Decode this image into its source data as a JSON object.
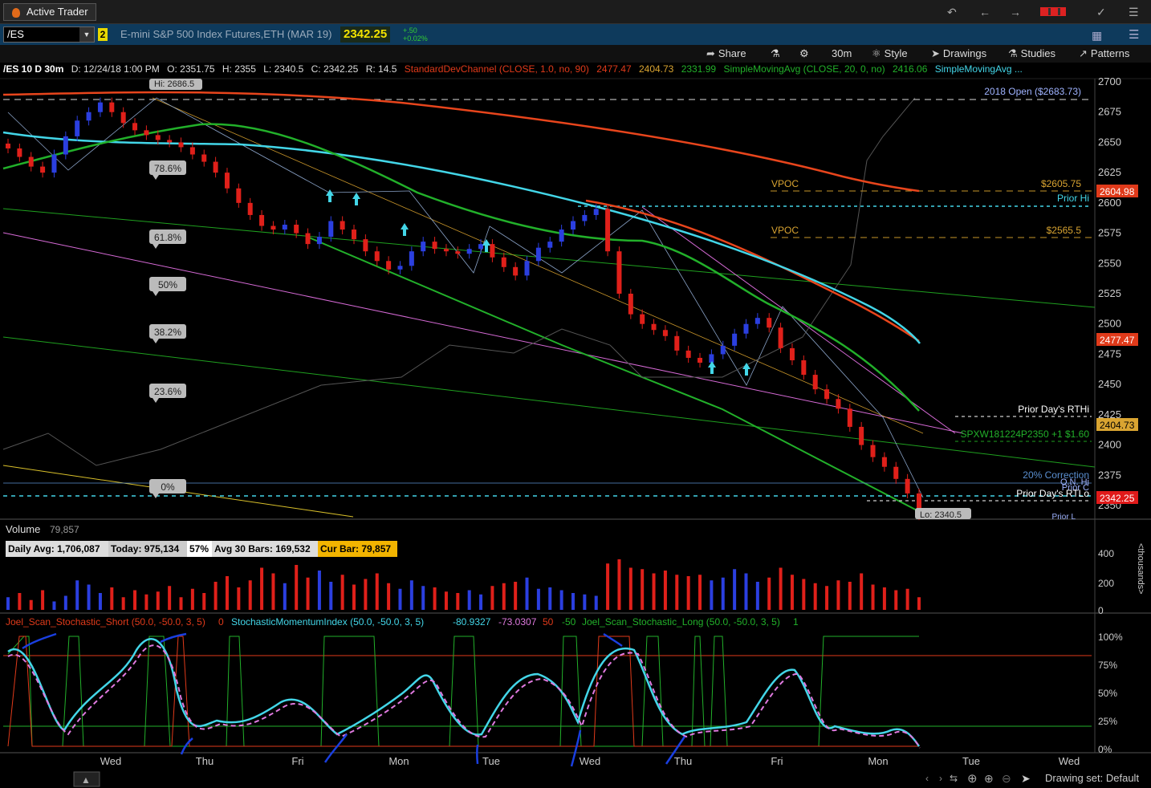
{
  "app": {
    "title": "Active Trader"
  },
  "symbol": {
    "ticker": "/ES",
    "link": "2",
    "description": "E-mini S&P 500 Index Futures,ETH (MAR 19)",
    "last": "2342.25",
    "change": "+.50",
    "change_pct": "+0.02%"
  },
  "toolbar": {
    "share": "Share",
    "timeframe": "30m",
    "style": "Style",
    "drawings": "Drawings",
    "studies": "Studies",
    "patterns": "Patterns"
  },
  "infobar": {
    "chart_name": "/ES 10 D 30m",
    "date": "D: 12/24/18 1:00 PM",
    "open": "O: 2351.75",
    "high": "H: 2355",
    "low": "L: 2340.5",
    "close": "C: 2342.25",
    "range": "R: 14.5",
    "sdc_label": "StandardDevChannel (CLOSE, 1.0, no, 90)",
    "sdc_v1": "2477.47",
    "sdc_v2": "2404.73",
    "sdc_v3": "2331.99",
    "sma_label": "SimpleMovingAvg (CLOSE, 20, 0, no)",
    "sma_v": "2416.06",
    "sma2_label": "SimpleMovingAvg ..."
  },
  "price_axis": {
    "ticks": [
      "2700",
      "2675",
      "2650",
      "2625",
      "2600",
      "2575",
      "2550",
      "2525",
      "2500",
      "2475",
      "2450",
      "2425",
      "2400",
      "2375",
      "2350"
    ],
    "badges": {
      "top": "2604.98",
      "mid": "2477.47",
      "sdc": "2404.73",
      "last": "2342.25"
    }
  },
  "annotations": {
    "hi": "Hi: 2686.5",
    "lo": "Lo: 2340.5",
    "open_2018": "2018 Open ($2683.73)",
    "vpoc1": "VPOC",
    "vpoc1_price": "$2605.75",
    "prior_hi": "Prior Hi",
    "vpoc2": "VPOC",
    "vpoc2_price": "$2565.5",
    "prior_rthi": "Prior Day's RTHi",
    "spxw": "SPXW181224P2350 +1 $1.60",
    "correction": "20% Correction",
    "on_hi": "O.N. Hi",
    "prior_c": "Prior C",
    "prior_rtlo": "Prior Day's RTLo",
    "prior_lo": "Prior L",
    "fib": [
      "78.6%",
      "61.8%",
      "50%",
      "38.2%",
      "23.6%",
      "0%"
    ]
  },
  "volume": {
    "title": "Volume",
    "value": "79,857",
    "daily_avg": "Daily Avg: 1,706,087",
    "today": "Today: 975,134",
    "pct": "57%",
    "avg30": "Avg 30 Bars: 169,532",
    "cur_bar": "Cur Bar: 79,857",
    "ticks": [
      "400",
      "200",
      "0"
    ],
    "unit": "<thousands>"
  },
  "oscillator": {
    "short_label": "Joel_Scan_Stochastic_Short (50.0, -50.0, 3, 5)",
    "short_val": "0",
    "smi_label": "StochasticMomentumIndex (50.0, -50.0, 3, 5)",
    "smi_v1": "-80.9327",
    "smi_v2": "-73.0307",
    "smi_v3": "50",
    "smi_v4": "-50",
    "long_label": "Joel_Scan_Stochastic_Long (50.0, -50.0, 3, 5)",
    "long_val": "1",
    "ticks": [
      "100%",
      "75%",
      "50%",
      "25%",
      "0%"
    ]
  },
  "time_axis": [
    "Wed",
    "Thu",
    "Fri",
    "Mon",
    "Tue",
    "Wed",
    "Thu",
    "Fri",
    "Mon",
    "Tue",
    "Wed"
  ],
  "footer": {
    "drawing_set": "Drawing set: Default"
  },
  "colors": {
    "up": "#2b3fe0",
    "down": "#e0201a",
    "sma_cyan": "#43d6e8",
    "sma_green": "#22b02a",
    "sma_red": "#e8451c",
    "pink": "#e07ae0",
    "gold": "#d9a431"
  },
  "chart_data": {
    "type": "candlestick",
    "title": "/ES 10 D 30m",
    "ylim": [
      2335,
      2705
    ],
    "close": [
      2645,
      2638,
      2630,
      2625,
      2640,
      2655,
      2668,
      2675,
      2683,
      2675,
      2666,
      2660,
      2656,
      2652,
      2650,
      2646,
      2640,
      2634,
      2625,
      2612,
      2600,
      2590,
      2581,
      2578,
      2582,
      2575,
      2566,
      2572,
      2585,
      2578,
      2570,
      2560,
      2552,
      2545,
      2548,
      2560,
      2568,
      2562,
      2560,
      2558,
      2562,
      2566,
      2555,
      2547,
      2540,
      2552,
      2563,
      2568,
      2578,
      2585,
      2590,
      2595,
      2560,
      2525,
      2508,
      2500,
      2495,
      2490,
      2478,
      2472,
      2468,
      2475,
      2482,
      2492,
      2500,
      2505,
      2497,
      2480,
      2470,
      2458,
      2446,
      2438,
      2430,
      2415,
      2400,
      2390,
      2382,
      2372,
      2360,
      2342
    ],
    "volume_k": [
      90,
      120,
      70,
      140,
      60,
      100,
      210,
      180,
      120,
      160,
      90,
      140,
      110,
      130,
      170,
      90,
      150,
      120,
      200,
      240,
      160,
      210,
      300,
      260,
      190,
      320,
      230,
      280,
      200,
      250,
      180,
      220,
      260,
      190,
      150,
      210,
      170,
      160,
      130,
      120,
      140,
      110,
      170,
      190,
      200,
      230,
      150,
      160,
      140,
      120,
      110,
      100,
      330,
      360,
      300,
      290,
      260,
      280,
      250,
      240,
      250,
      210,
      230,
      290,
      260,
      200,
      230,
      300,
      250,
      220,
      190,
      170,
      210,
      200,
      260,
      180,
      160,
      140,
      150,
      90
    ]
  }
}
